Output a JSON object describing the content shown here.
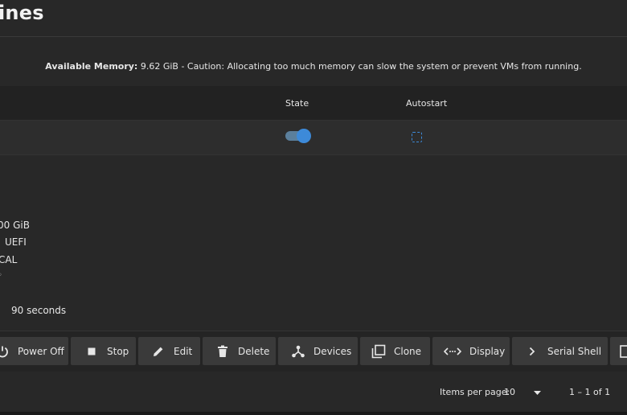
{
  "page": {
    "title": "ines"
  },
  "memory": {
    "label": "Available Memory:",
    "text": " 9.62 GiB - Caution: Allocating too much memory can slow the system or prevent VMs from running."
  },
  "table": {
    "columns": {
      "state": "State",
      "autostart": "Autostart"
    },
    "row": {
      "state_on": true,
      "autostart_checked": false
    }
  },
  "details": {
    "memory_fragment": "00 GiB",
    "boot_fragment": "UEFI",
    "clock_fragment": "CAL",
    "shutdown_timeout": "90 seconds"
  },
  "actions": {
    "power_off": "Power Off",
    "stop": "Stop",
    "edit": "Edit",
    "delete": "Delete",
    "devices": "Devices",
    "clone": "Clone",
    "display": "Display",
    "serial_shell": "Serial Shell"
  },
  "icons": {
    "power_off": "power-icon",
    "stop": "stop-icon",
    "edit": "pencil-icon",
    "delete": "trash-icon",
    "devices": "devices-icon",
    "clone": "clone-icon",
    "display": "display-icon",
    "serial_shell": "chevron-right-icon",
    "more": "log-icon"
  },
  "pagination": {
    "items_per_page_label": "Items per page:",
    "items_per_page_value": "10",
    "range": "1 – 1 of 1"
  },
  "colors": {
    "accent": "#3d8ad9",
    "background": "#282828",
    "button": "#3a3a3a"
  }
}
